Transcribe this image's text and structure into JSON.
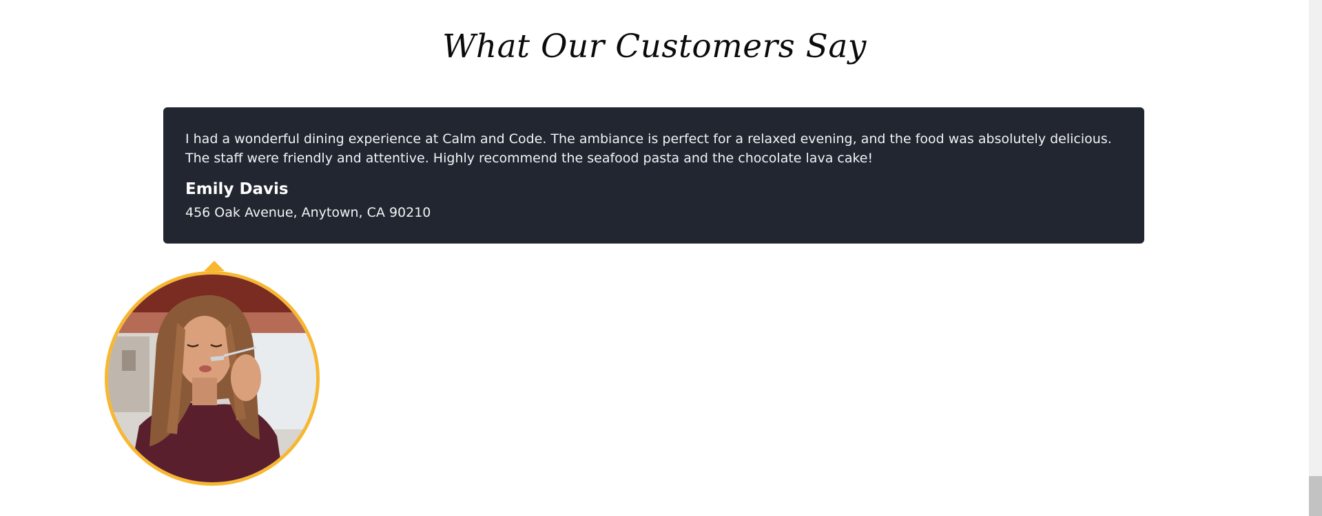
{
  "section": {
    "title": "What Our Customers Say"
  },
  "testimonial": {
    "quote": "I had a wonderful dining experience at Calm and Code. The ambiance is perfect for a relaxed evening, and the food was absolutely delicious. The staff were friendly and attentive. Highly recommend the seafood pasta and the chocolate lava cake!",
    "name": "Emily Davis",
    "address": "456 Oak Avenue, Anytown, CA 90210"
  },
  "colors": {
    "card_background": "#212631",
    "accent": "#f8b731",
    "page_background": "#ffffff"
  },
  "icons": {
    "avatar": "customer-photo",
    "pointer": "caret-up-icon"
  }
}
